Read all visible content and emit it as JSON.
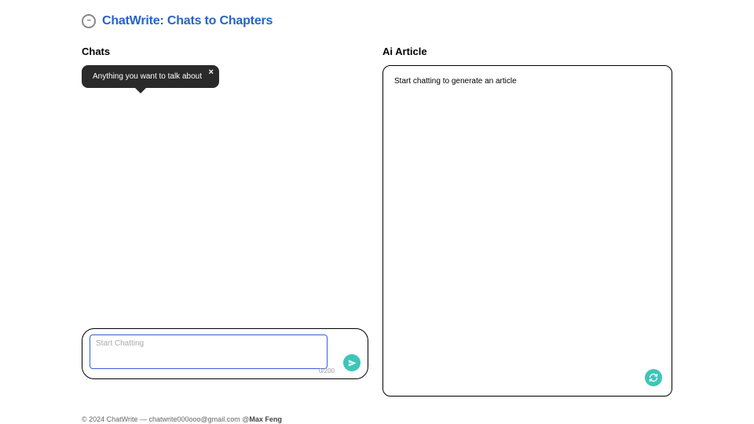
{
  "header": {
    "title": "ChatWrite: Chats to Chapters"
  },
  "chats": {
    "section_label": "Chats",
    "tooltip_text": "Anything you want to talk about",
    "tooltip_close": "×",
    "input_placeholder": "Start Chatting",
    "char_counter": "0/200"
  },
  "article": {
    "section_label": "Ai Article",
    "placeholder": "Start chatting to generate an article"
  },
  "footer": {
    "copyright": "© 2024 ChatWrite — ",
    "email": "chatwrite000ooo@gmail.com",
    "author_prefix": "  @",
    "author": "Max Feng"
  },
  "colors": {
    "accent": "#3ec5b8",
    "title": "#2563c9",
    "input_border": "#3b5bdb"
  }
}
